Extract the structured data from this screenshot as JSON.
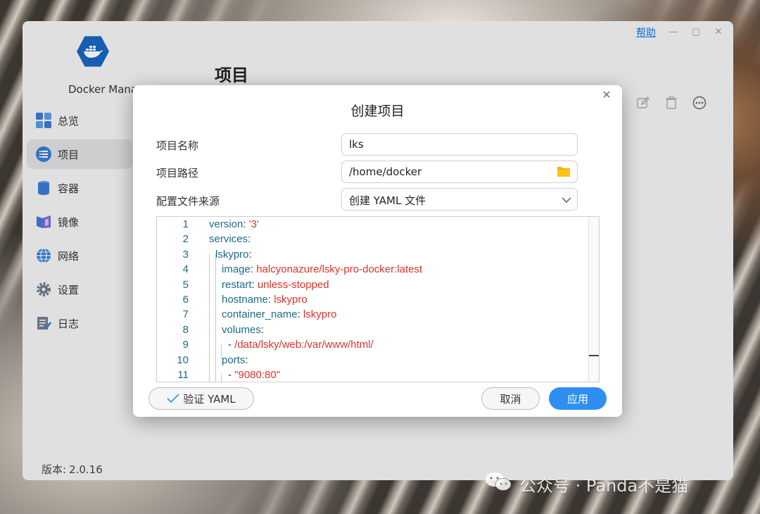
{
  "window": {
    "help_label": "帮助",
    "app_name": "Docker Mana",
    "page_title": "项目",
    "version_label": "版本:",
    "version_value": "2.0.16"
  },
  "sidebar": {
    "items": [
      {
        "label": "总览",
        "icon": "overview-grid-icon"
      },
      {
        "label": "项目",
        "icon": "project-list-icon",
        "active": true
      },
      {
        "label": "容器",
        "icon": "container-icon"
      },
      {
        "label": "镜像",
        "icon": "image-icon"
      },
      {
        "label": "网络",
        "icon": "network-globe-icon"
      },
      {
        "label": "设置",
        "icon": "gear-icon"
      },
      {
        "label": "日志",
        "icon": "log-icon"
      }
    ]
  },
  "dialog": {
    "title": "创建项目",
    "name_label": "项目名称",
    "name_value": "lks",
    "path_label": "项目路径",
    "path_value": "/home/docker",
    "source_label": "配置文件来源",
    "source_value": "创建 YAML 文件",
    "validate_label": "验证 YAML",
    "cancel_label": "取消",
    "apply_label": "应用"
  },
  "editor": {
    "lines": [
      {
        "n": "1",
        "key": "version",
        "sep": ": ",
        "val": "'3'"
      },
      {
        "n": "2",
        "key": "services",
        "sep": ":",
        "val": ""
      },
      {
        "n": "3",
        "key": "lskypro",
        "sep": ":",
        "val": ""
      },
      {
        "n": "4",
        "key": "image",
        "sep": ": ",
        "val": "halcyonazure/lsky-pro-docker:latest"
      },
      {
        "n": "5",
        "key": "restart",
        "sep": ": ",
        "val": "unless-stopped"
      },
      {
        "n": "6",
        "key": "hostname",
        "sep": ": ",
        "val": "lskypro"
      },
      {
        "n": "7",
        "key": "container_name",
        "sep": ": ",
        "val": "lskypro"
      },
      {
        "n": "8",
        "key": "volumes",
        "sep": ":",
        "val": ""
      },
      {
        "n": "9",
        "key": "",
        "sep": "- ",
        "val": "/data/lsky/web:/var/www/html/"
      },
      {
        "n": "10",
        "key": "ports",
        "sep": ":",
        "val": ""
      },
      {
        "n": "11",
        "key": "",
        "sep": "- ",
        "val": "\"9080:80\""
      }
    ]
  },
  "watermark": {
    "text": "公众号 · Panda不是猫"
  },
  "colors": {
    "accent": "#2f8ff0",
    "yaml_key": "#1d6a8a",
    "yaml_value": "#d9342b",
    "folder": "#f5b400"
  }
}
